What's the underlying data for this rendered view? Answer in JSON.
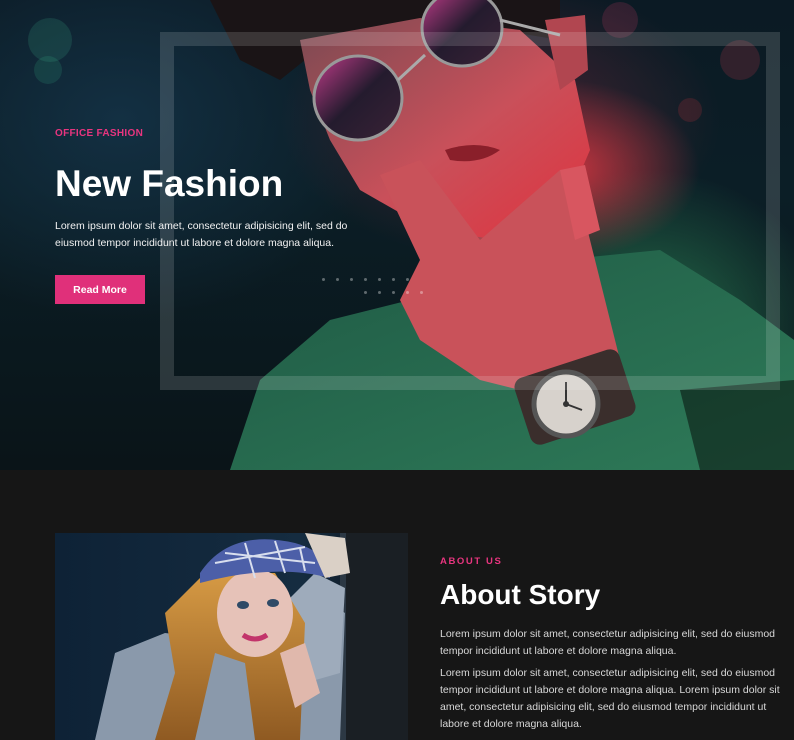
{
  "hero": {
    "eyebrow": "OFFICE FASHION",
    "title": "New Fashion",
    "text": "Lorem ipsum dolor sit amet, consectetur adipisicing elit, sed do eiusmod tempor incididunt ut labore et dolore magna aliqua.",
    "button_label": "Read More"
  },
  "about": {
    "eyebrow": "ABOUT US",
    "title": "About Story",
    "paragraph1": "Lorem ipsum dolor sit amet, consectetur adipisicing elit, sed do eiusmod tempor incididunt ut labore et dolore magna aliqua.",
    "paragraph2": "Lorem ipsum dolor sit amet, consectetur adipisicing elit, sed do eiusmod tempor incididunt ut labore et dolore magna aliqua. Lorem ipsum dolor sit amet, consectetur adipisicing elit, sed do eiusmod tempor incididunt ut labore et dolore magna aliqua."
  },
  "colors": {
    "accent": "#e0307a",
    "background": "#161616"
  }
}
